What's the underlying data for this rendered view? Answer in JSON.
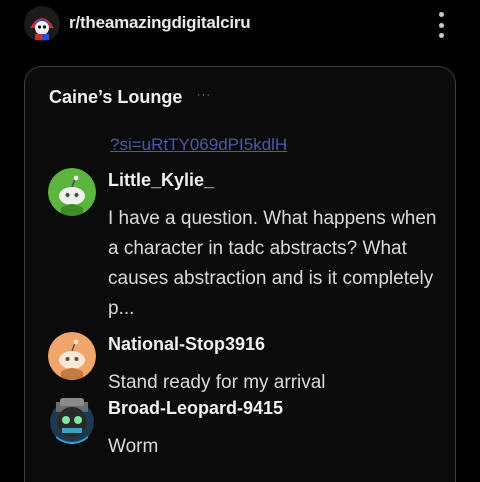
{
  "header": {
    "subreddit": "r/theamazingdigitalciru",
    "menu_icon": "kebab-vertical-icon"
  },
  "card": {
    "title": "Caine’s Lounge",
    "title_indicator": "···",
    "link_text": "?si=uRtTY069dPI5kdlH"
  },
  "messages": [
    {
      "user": "Little_Kylie_",
      "avatar_color": "#5cb53f",
      "text": "I have a question. What happens when a character in tadc abstracts? What causes abstraction and is it completely p..."
    },
    {
      "user": "National-Stop3916",
      "avatar_color": "#f0a56a",
      "text": "Stand ready for my arrival"
    },
    {
      "user": "Broad-Leopard-9415",
      "avatar_color": "#3a9ad9",
      "text": "Worm"
    }
  ]
}
